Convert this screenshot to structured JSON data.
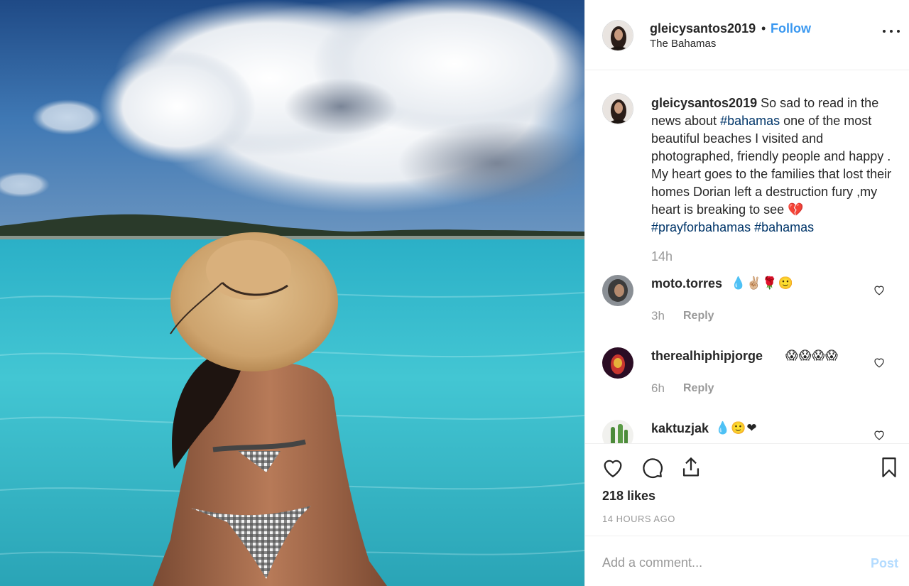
{
  "post": {
    "username": "gleicysantos2019",
    "separator": "•",
    "follow_label": "Follow",
    "location": "The Bahamas"
  },
  "caption": {
    "username": "gleicysantos2019",
    "text_1": " So sad to read in the news about ",
    "tag_1": "#bahamas",
    "text_2": " one of the most beautiful beaches I visited and photographed, friendly people and happy . My heart goes to the families that lost their homes Dorian left a destruction fury ,my heart is breaking to see ",
    "broken_heart": "💔",
    "tag_2": "#prayforbahamas",
    "tag_3": "#bahamas",
    "time": "14h"
  },
  "comments": [
    {
      "username": "moto.torres",
      "text": "💧✌🏼🌹🙂",
      "time": "3h",
      "reply_label": "Reply"
    },
    {
      "username": "therealhiphipjorge",
      "text": "😱😱😱😱",
      "time": "6h",
      "reply_label": "Reply"
    },
    {
      "username": "kaktuzjak",
      "text": "💧🙂❤",
      "time": "",
      "reply_label": ""
    }
  ],
  "actions": {
    "likes": "218 likes",
    "time_ago": "14 HOURS AGO"
  },
  "add_comment": {
    "placeholder": "Add a comment...",
    "post_label": "Post"
  },
  "colors": {
    "link": "#3897f0",
    "hashtag": "#003569",
    "muted": "#999999",
    "post_disabled": "#b3dbff"
  },
  "icons": [
    "more-options-icon",
    "heart-icon",
    "comment-icon",
    "share-icon",
    "bookmark-icon"
  ]
}
